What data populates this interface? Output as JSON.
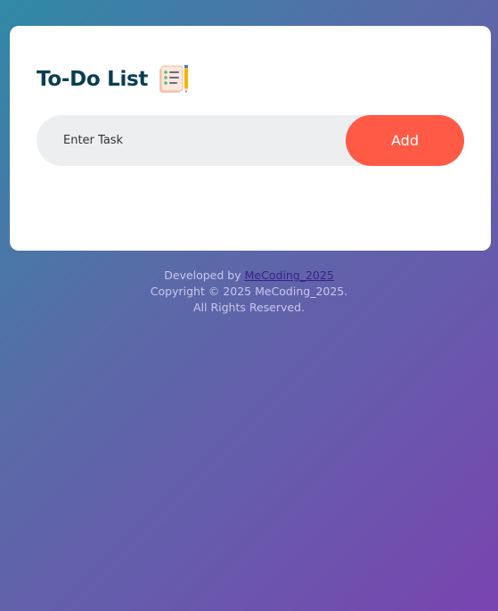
{
  "app": {
    "title": "To-Do List",
    "title_icon": "checklist-notepad-pencil-icon"
  },
  "task_input": {
    "placeholder": "Enter Task",
    "value": ""
  },
  "add_button": {
    "label": "Add"
  },
  "footer": {
    "developed_prefix": "Developed by ",
    "developer_link_text": "MeCoding_2025",
    "copyright": "Copyright © 2025 MeCoding_2025.",
    "rights": "All Rights Reserved."
  },
  "colors": {
    "title": "#0a3d52",
    "accent_button": "#ff5a45",
    "input_background": "#edeef0",
    "card_background": "#ffffff",
    "gradient_start": "#2f8aa6",
    "gradient_end": "#7a44b0"
  }
}
